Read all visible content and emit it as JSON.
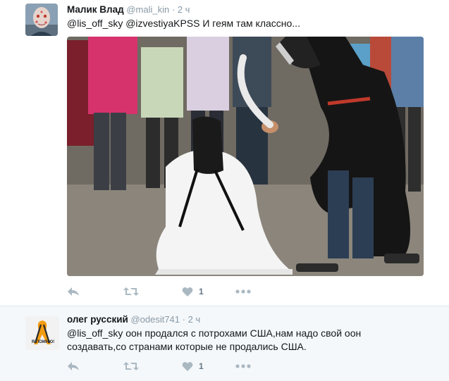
{
  "tweets": [
    {
      "name": "Малик Влад",
      "handle": "@mali_kin",
      "separator": "·",
      "time": "2 ч",
      "text": "@lis_off_sky @izvestiyaKPSS И геям там классно...",
      "actions": {
        "like_count": "1"
      }
    },
    {
      "name": "олег русский",
      "handle": "@odesit741",
      "separator": "·",
      "time": "2 ч",
      "text_line1": "@lis_off_sky оон продался с потрохами США,нам надо свой оон",
      "text_line2": "создавать,со странами которые не продались США.",
      "avatar_caption": "Я ПОМНЮ!",
      "actions": {
        "like_count": "1"
      }
    }
  ],
  "colors": {
    "text": "#14171a",
    "secondary": "#8899a6",
    "action_icon": "#aab8c2",
    "divider": "#e1e8ed"
  },
  "icons": [
    "reply-icon",
    "retweet-icon",
    "like-icon",
    "more-icon"
  ]
}
